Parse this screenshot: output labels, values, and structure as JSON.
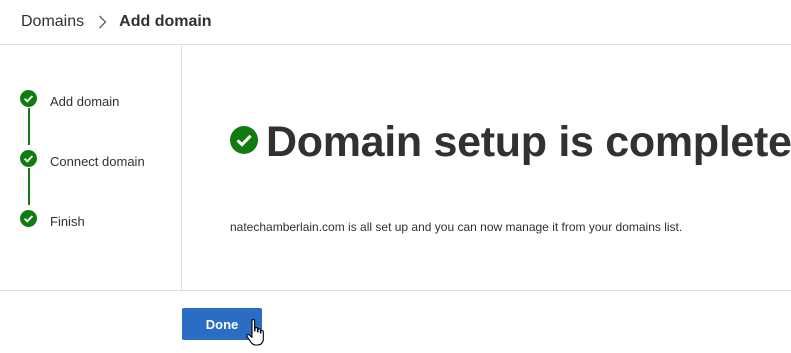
{
  "breadcrumb": {
    "root": "Domains",
    "current": "Add domain",
    "separator_icon": "chevron-right-icon"
  },
  "steps": [
    {
      "label": "Add domain",
      "status": "complete",
      "icon": "check-circle-icon"
    },
    {
      "label": "Connect domain",
      "status": "complete",
      "icon": "check-circle-icon"
    },
    {
      "label": "Finish",
      "status": "complete",
      "icon": "check-circle-icon"
    }
  ],
  "main": {
    "title": "Domain setup is complete",
    "title_icon": "check-circle-icon",
    "message": "natechamberlain.com is all set up and you can now manage it from your domains list."
  },
  "footer": {
    "done_label": "Done"
  },
  "colors": {
    "success": "#107c10",
    "primary": "#2b6cc4",
    "divider": "#e1dfdd",
    "text": "#323130"
  }
}
